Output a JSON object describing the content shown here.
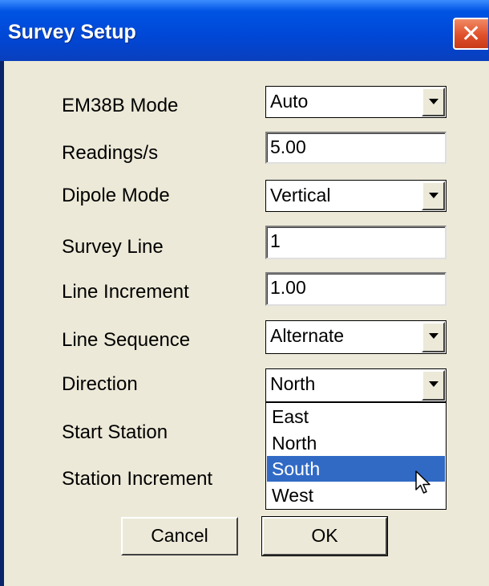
{
  "window": {
    "title": "Survey Setup",
    "close_glyph": "✕"
  },
  "form": {
    "em38b_mode": {
      "label": "EM38B Mode",
      "value": "Auto"
    },
    "readings_per_s": {
      "label": "Readings/s",
      "value": "5.00"
    },
    "dipole_mode": {
      "label": "Dipole Mode",
      "value": "Vertical"
    },
    "survey_line": {
      "label": "Survey Line",
      "value": "1"
    },
    "line_increment": {
      "label": "Line Increment",
      "value": "1.00"
    },
    "line_sequence": {
      "label": "Line Sequence",
      "value": "Alternate"
    },
    "direction": {
      "label": "Direction",
      "value": "North",
      "options": [
        "East",
        "North",
        "South",
        "West"
      ],
      "highlighted": "South"
    },
    "start_station": {
      "label": "Start Station"
    },
    "station_increment": {
      "label": "Station Increment"
    }
  },
  "buttons": {
    "cancel": "Cancel",
    "ok": "OK"
  },
  "colors": {
    "titlebar": "#0054e3",
    "dialog_bg": "#ece9d8",
    "selection": "#316ac5",
    "close_button": "#e0502a"
  },
  "icons": {
    "close": "close-icon",
    "dropdown": "chevron-down-icon",
    "cursor": "mouse-pointer-icon"
  }
}
